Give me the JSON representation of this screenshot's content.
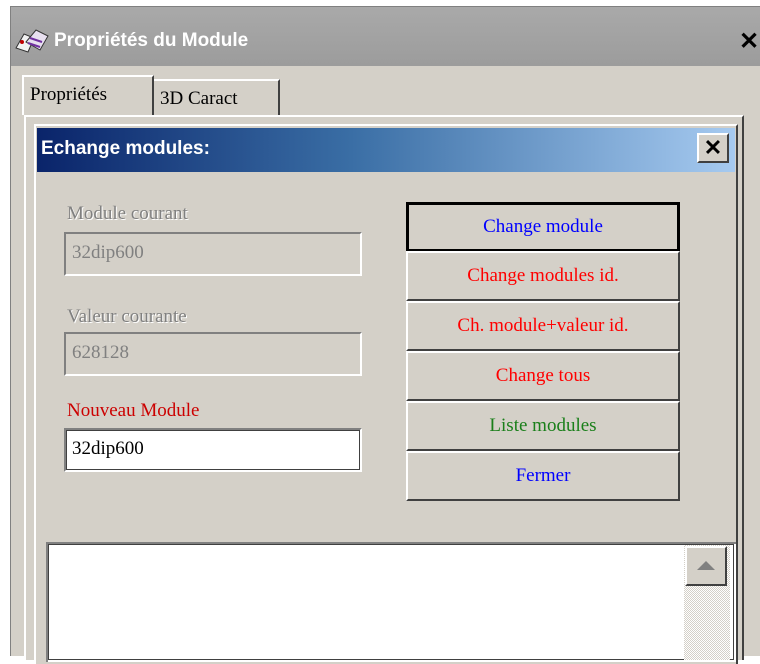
{
  "window": {
    "title": "Propriétés du Module",
    "close_label": "✕"
  },
  "tabs": [
    {
      "label": "Propriétés"
    },
    {
      "label": "3D Caract"
    }
  ],
  "dialog": {
    "title": "Echange modules:",
    "close_label": "✕",
    "fields": {
      "module_courant": {
        "label": "Module courant",
        "value": "32dip600"
      },
      "valeur_courante": {
        "label": "Valeur courante",
        "value": "628128"
      },
      "nouveau_module": {
        "label": "Nouveau Module",
        "value": "32dip600"
      }
    },
    "buttons": {
      "change_module": "Change module",
      "change_modules_id": "Change modules id.",
      "ch_module_valeur_id": "Ch.  module+valeur id.",
      "change_tous": "Change tous",
      "liste_modules": "Liste modules",
      "fermer": "Fermer"
    }
  },
  "colors": {
    "dialog_title_gradient": [
      "#0a246a",
      "#a6caf0"
    ],
    "blue_button_text": "#0000ff",
    "red_button_text": "#ff0000",
    "green_button_text": "#1a7f1a",
    "nouveau_label": "#cc0000"
  }
}
